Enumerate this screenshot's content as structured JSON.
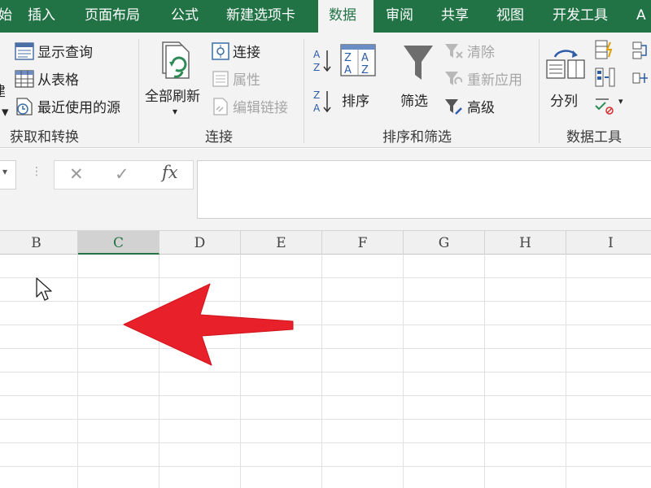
{
  "tabs": [
    {
      "label": "始",
      "active": false
    },
    {
      "label": "插入",
      "active": false
    },
    {
      "label": "页面布局",
      "active": false
    },
    {
      "label": "公式",
      "active": false
    },
    {
      "label": "新建选项卡",
      "active": false
    },
    {
      "label": "数据",
      "active": true
    },
    {
      "label": "审阅",
      "active": false
    },
    {
      "label": "共享",
      "active": false
    },
    {
      "label": "视图",
      "active": false
    },
    {
      "label": "开发工具",
      "active": false
    },
    {
      "label": "A",
      "active": false
    }
  ],
  "ribbon": {
    "get_transform": {
      "label": "获取和转换",
      "show_queries": "显示查询",
      "from_table": "从表格",
      "recent_sources": "最近使用的源",
      "partial_left": "建"
    },
    "connections": {
      "label": "连接",
      "refresh_all": "全部刷新",
      "connections": "连接",
      "properties": "属性",
      "edit_links": "编辑链接"
    },
    "sort_filter": {
      "label": "排序和筛选",
      "sort": "排序",
      "filter": "筛选",
      "clear": "清除",
      "reapply": "重新应用",
      "advanced": "高级"
    },
    "data_tools": {
      "label": "数据工具",
      "text_to_columns": "分列"
    }
  },
  "formula_bar": {
    "cancel_symbol": "✕",
    "enter_symbol": "✓",
    "fx_symbol": "fx",
    "content": ""
  },
  "columns": [
    "B",
    "C",
    "D",
    "E",
    "F",
    "G",
    "H",
    "I"
  ],
  "selected_column": "C",
  "colors": {
    "accent": "#217346",
    "arrow": "#e8202a"
  }
}
